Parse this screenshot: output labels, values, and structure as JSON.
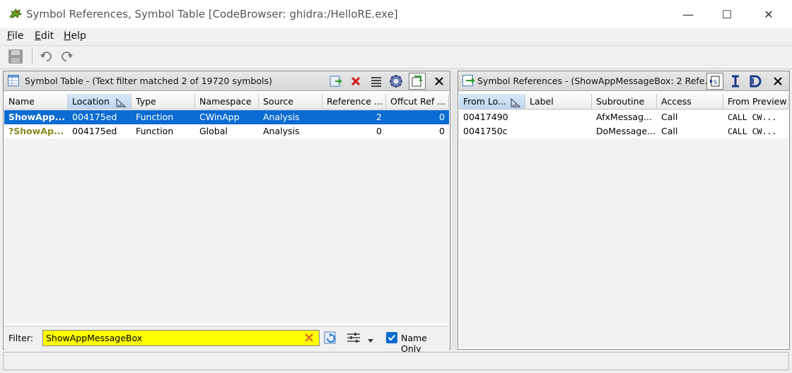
{
  "window": {
    "title": "Symbol References, Symbol Table [CodeBrowser: ghidra:/HelloRE.exe]",
    "minimize": "—",
    "maximize": "☐",
    "close": "✕"
  },
  "menu": {
    "file": {
      "u": "F",
      "rest": "ile"
    },
    "edit": {
      "u": "E",
      "rest": "dit"
    },
    "help": {
      "u": "H",
      "rest": "elp"
    }
  },
  "symbol_table": {
    "title": "Symbol Table -  (Text filter matched 2 of 19720 symbols)",
    "columns": [
      "Name",
      "Location",
      "Type",
      "Namespace",
      "Source",
      "Reference ...",
      "Offcut Ref ..."
    ],
    "rows": [
      {
        "name": "ShowApp...",
        "location": "004175ed",
        "type": "Function",
        "namespace": "CWinApp",
        "source": "Analysis",
        "refs": "2",
        "offcut": "0"
      },
      {
        "name": "?ShowAp...",
        "location": "004175ed",
        "type": "Function",
        "namespace": "Global",
        "source": "Analysis",
        "refs": "0",
        "offcut": "0"
      }
    ],
    "filter": {
      "label": "Filter:",
      "value": "ShowAppMessageBox",
      "name_only_label": "Name Only",
      "name_only_checked": true
    }
  },
  "symbol_refs": {
    "title": "Symbol References - (ShowAppMessageBox: 2 Refe...",
    "columns": [
      "From Lo...",
      "Label",
      "Subroutine",
      "Access",
      "From Preview"
    ],
    "rows": [
      {
        "from": "00417490",
        "label": "",
        "subroutine": "AfxMessag...",
        "access": "Call",
        "preview": "CALL CW..."
      },
      {
        "from": "0041750c",
        "label": "",
        "subroutine": "DoMessage...",
        "access": "Call",
        "preview": "CALL CW..."
      }
    ]
  },
  "colors": {
    "selection": "#0a6cd2",
    "filter_bg": "#ffff00",
    "other_symbol_text": "#8a8a1e"
  }
}
